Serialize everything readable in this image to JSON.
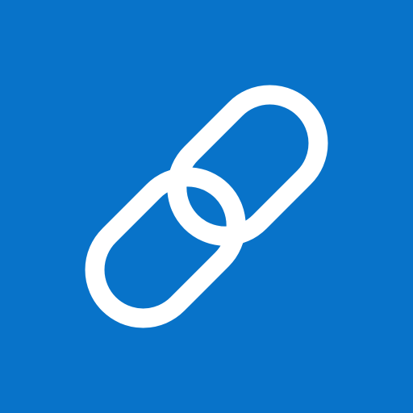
{
  "icon": {
    "name": "link-icon",
    "background_color": "#0873c9",
    "glyph_color": "#ffffff"
  }
}
